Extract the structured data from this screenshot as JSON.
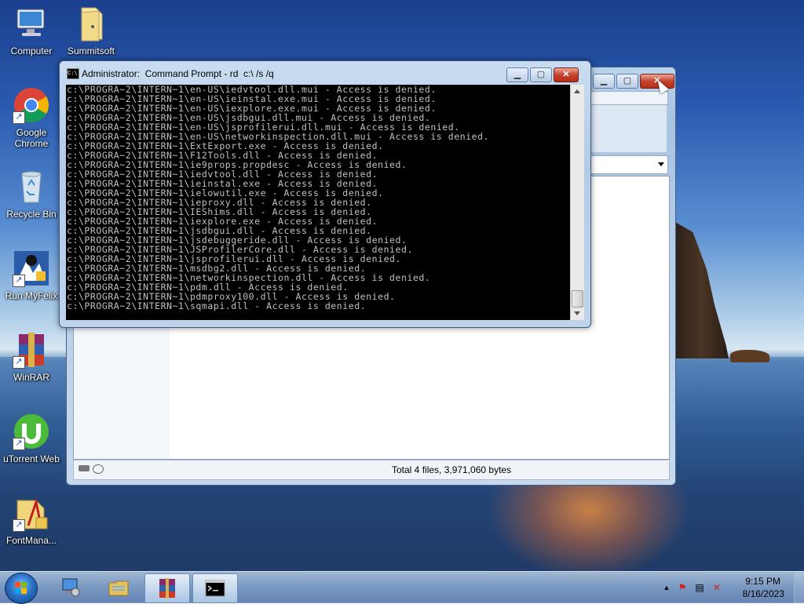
{
  "desktop": {
    "icons": [
      {
        "label": "Computer",
        "icon": "computer-icon"
      },
      {
        "label": "Summitsoft",
        "icon": "folder-icon"
      },
      {
        "label": "Google Chrome",
        "icon": "chrome-icon"
      },
      {
        "label": "Recycle Bin",
        "icon": "recycle-bin-icon"
      },
      {
        "label": "Run MyFelix",
        "icon": "app-icon"
      },
      {
        "label": "WinRAR",
        "icon": "winrar-icon"
      },
      {
        "label": "uTorrent Web",
        "icon": "utorrent-icon"
      },
      {
        "label": "FontMana...",
        "icon": "font-manager-icon"
      }
    ]
  },
  "explorer": {
    "status_text": "Total 4 files, 3,971,060 bytes"
  },
  "cmd": {
    "title": "Administrator:  Command Prompt - rd  c:\\ /s /q",
    "icon_text": "C:\\",
    "lines": [
      "c:\\PROGRA~2\\INTERN~1\\en-US\\iedvtool.dll.mui - Access is denied.",
      "c:\\PROGRA~2\\INTERN~1\\en-US\\ieinstal.exe.mui - Access is denied.",
      "c:\\PROGRA~2\\INTERN~1\\en-US\\iexplore.exe.mui - Access is denied.",
      "c:\\PROGRA~2\\INTERN~1\\en-US\\jsdbgui.dll.mui - Access is denied.",
      "c:\\PROGRA~2\\INTERN~1\\en-US\\jsprofilerui.dll.mui - Access is denied.",
      "c:\\PROGRA~2\\INTERN~1\\en-US\\networkinspection.dll.mui - Access is denied.",
      "c:\\PROGRA~2\\INTERN~1\\ExtExport.exe - Access is denied.",
      "c:\\PROGRA~2\\INTERN~1\\F12Tools.dll - Access is denied.",
      "c:\\PROGRA~2\\INTERN~1\\ie9props.propdesc - Access is denied.",
      "c:\\PROGRA~2\\INTERN~1\\iedvtool.dll - Access is denied.",
      "c:\\PROGRA~2\\INTERN~1\\ieinstal.exe - Access is denied.",
      "c:\\PROGRA~2\\INTERN~1\\ielowutil.exe - Access is denied.",
      "c:\\PROGRA~2\\INTERN~1\\ieproxy.dll - Access is denied.",
      "c:\\PROGRA~2\\INTERN~1\\IEShims.dll - Access is denied.",
      "c:\\PROGRA~2\\INTERN~1\\iexplore.exe - Access is denied.",
      "c:\\PROGRA~2\\INTERN~1\\jsdbgui.dll - Access is denied.",
      "c:\\PROGRA~2\\INTERN~1\\jsdebuggeride.dll - Access is denied.",
      "c:\\PROGRA~2\\INTERN~1\\JSProfilerCore.dll - Access is denied.",
      "c:\\PROGRA~2\\INTERN~1\\jsprofilerui.dll - Access is denied.",
      "c:\\PROGRA~2\\INTERN~1\\msdbg2.dll - Access is denied.",
      "c:\\PROGRA~2\\INTERN~1\\networkinspection.dll - Access is denied.",
      "c:\\PROGRA~2\\INTERN~1\\pdm.dll - Access is denied.",
      "c:\\PROGRA~2\\INTERN~1\\pdmproxy100.dll - Access is denied.",
      "c:\\PROGRA~2\\INTERN~1\\sqmapi.dll - Access is denied."
    ]
  },
  "taskbar": {
    "items": [
      "server-manager-icon",
      "windows-explorer-icon",
      "winrar-icon",
      "command-prompt-icon"
    ],
    "active_item": "winrar-icon",
    "clock_time": "9:15 PM",
    "clock_date": "8/16/2023"
  },
  "colors": {
    "console_bg": "#000000",
    "console_text": "#c0c0c0",
    "close_button": "#c7432c"
  }
}
